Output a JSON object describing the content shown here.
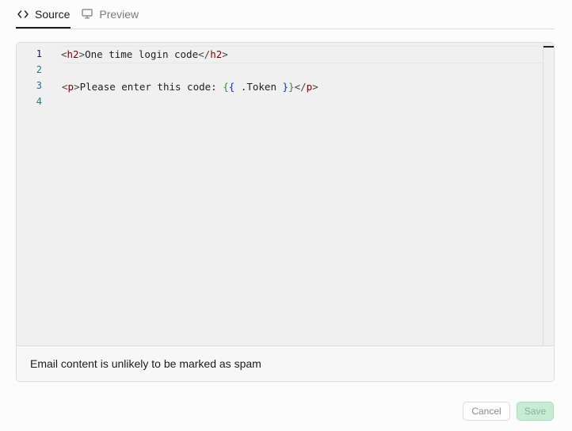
{
  "tabs": [
    {
      "label": "Source",
      "icon": "code-icon",
      "active": true
    },
    {
      "label": "Preview",
      "icon": "monitor-icon",
      "active": false
    }
  ],
  "editor": {
    "line_numbers": [
      "1",
      "2",
      "3",
      "4"
    ],
    "current_line": 1,
    "lines": [
      "<h2>One time login code</h2>",
      "",
      "<p>Please enter this code: {{ .Token }}</p>",
      ""
    ]
  },
  "spam_status": "Email content is unlikely to be marked as spam",
  "buttons": {
    "cancel_label": "Cancel",
    "save_label": "Save"
  },
  "colors": {
    "tag": "#800000",
    "brace_outer": "#319331",
    "brace_inner": "#0431fa",
    "save_bg": "#c6edd4",
    "line_number": "#237893"
  }
}
